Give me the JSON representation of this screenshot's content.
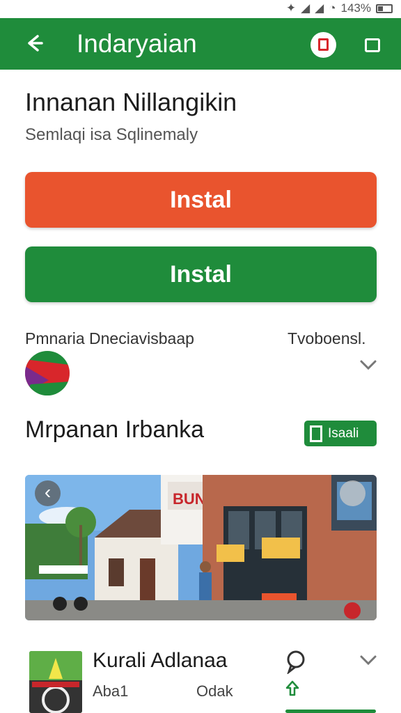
{
  "status_bar": {
    "battery_text": "143%"
  },
  "app_bar": {
    "title": "Indaryaian"
  },
  "headline": "Innanan Nillangikin",
  "subheadline": "Semlaqi isa Sqlinemaly",
  "buttons": {
    "install_primary": "Instal",
    "install_secondary": "Instal"
  },
  "info_row": {
    "label": "Pmnaria Dneciavisbaap",
    "right_text": "Tvoboensl."
  },
  "section": {
    "title": "Mrpanan Irbanka",
    "badge_label": "Isaali"
  },
  "app_item": {
    "name": "Kurali Adlanaa",
    "meta_left": "Aba1",
    "meta_right": "Odak"
  },
  "colors": {
    "brand_green": "#1f8c3b",
    "accent_orange": "#e9542e",
    "alert_red": "#d8262b"
  },
  "icons": [
    "back-arrow-icon",
    "alert-icon",
    "folder-icon",
    "flag-icon",
    "chevron-down-icon",
    "chat-bubble-icon",
    "upload-arrow-icon"
  ]
}
